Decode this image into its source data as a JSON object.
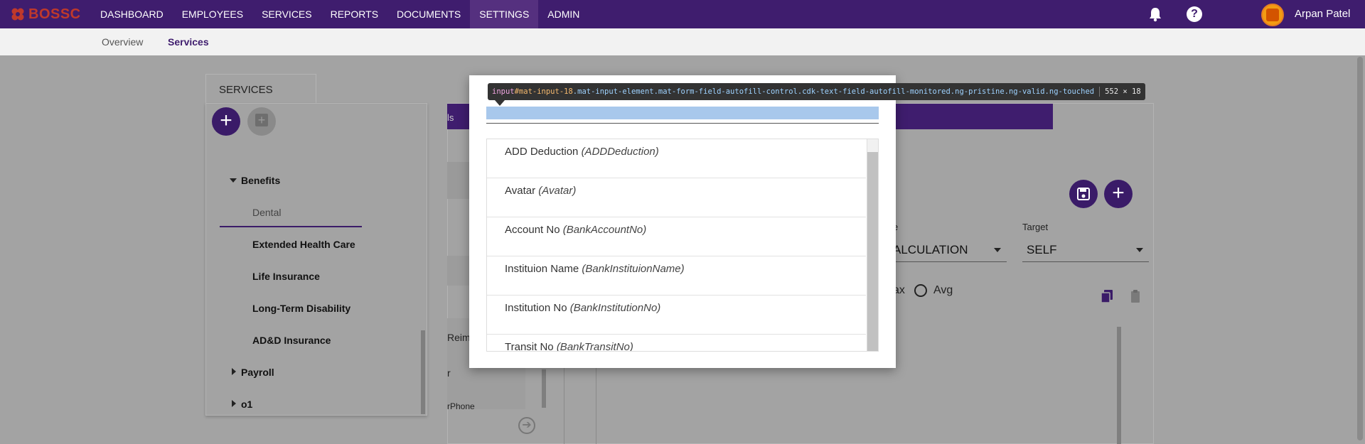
{
  "app": {
    "brand": "BOSSC",
    "nav": [
      "DASHBOARD",
      "EMPLOYEES",
      "SERVICES",
      "REPORTS",
      "DOCUMENTS",
      "SETTINGS",
      "ADMIN"
    ],
    "nav_active": "SETTINGS",
    "user_name": "Arpan Patel",
    "help_glyph": "?",
    "icons": [
      "bell-icon",
      "help-icon"
    ],
    "colors": {
      "primary": "#3f1d6e",
      "brand_red": "#c0392b",
      "selection_blue": "#a8c8ec"
    }
  },
  "subnav": {
    "items": [
      "Overview",
      "Services"
    ],
    "active": "Services"
  },
  "services_panel": {
    "tab_label": "SERVICES",
    "add_glyph": "+",
    "tree": {
      "benefits": "Benefits",
      "dental": "Dental",
      "extended_health": "Extended Health Care",
      "life": "Life Insurance",
      "ltd": "Long-Term Disability",
      "add": "AD&D Insurance",
      "payroll": "Payroll",
      "o1": "o1"
    },
    "selected": "Dental"
  },
  "background_form": {
    "tab_fragment": "ls",
    "list_fragments": [
      "Reimb",
      "r",
      "rPhone"
    ],
    "type_label_fragment": "e",
    "type_value_fragment": "ALCULATION",
    "target_label": "Target",
    "target_value": "SELF",
    "radio_max_fragment": "ax",
    "radio_avg": "Avg",
    "arrow_glyph": "➔"
  },
  "dialog": {
    "input_value": "",
    "options": [
      {
        "label": "ADD Deduction",
        "code": "(ADDDeduction)"
      },
      {
        "label": "Avatar",
        "code": "(Avatar)"
      },
      {
        "label": "Account No",
        "code": "(BankAccountNo)"
      },
      {
        "label": "Instituion Name",
        "code": "(BankInstituionName)"
      },
      {
        "label": "Institution No",
        "code": "(BankInstitutionNo)"
      },
      {
        "label": "Transit No",
        "code": "(BankTransitNo)"
      }
    ]
  },
  "devtools_tooltip": {
    "tag": "input",
    "id": "#mat-input-18",
    "classes": ".mat-input-element.mat-form-field-autofill-control.cdk-text-field-autofill-monitored.ng-pristine.ng-valid.ng-touched",
    "dimensions": "552 × 18"
  }
}
